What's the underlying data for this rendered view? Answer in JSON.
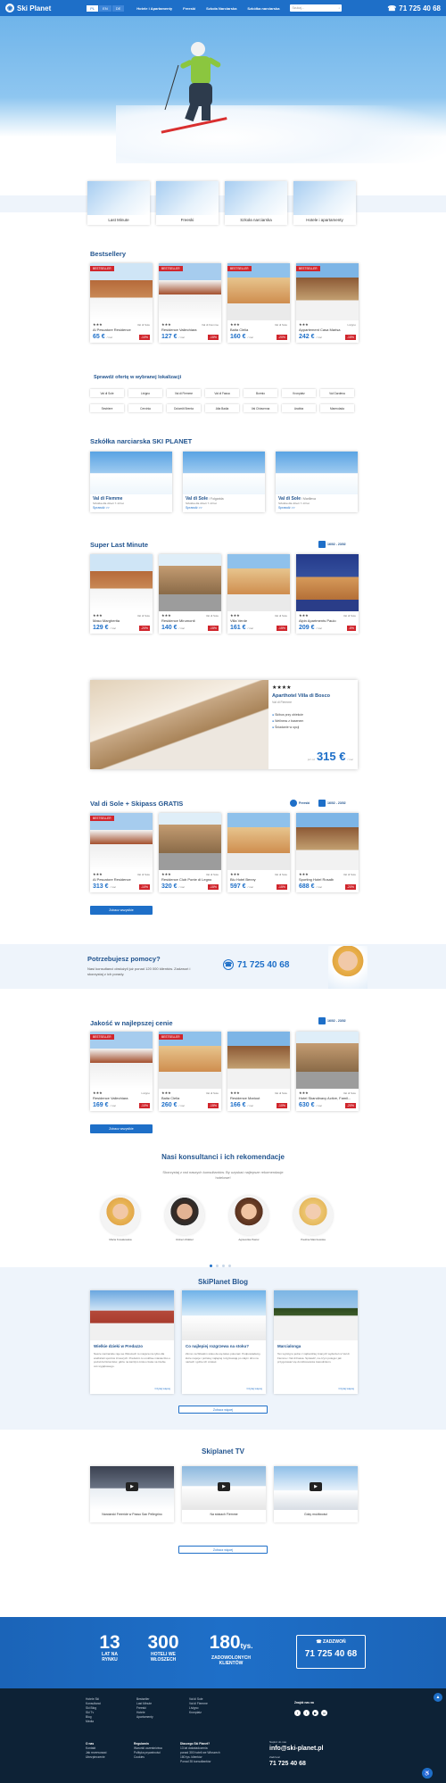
{
  "header": {
    "logo": "Ski Planet",
    "languages": [
      "PL",
      "EN",
      "DE"
    ],
    "nav": [
      "Hotele i Apartamenty",
      "Freeski",
      "Szkoła Narciarska",
      "Szkółka narciarska"
    ],
    "search_placeholder": "Szukaj...",
    "phone": "71 725 40 68"
  },
  "categories": [
    "Last Minute",
    "Freeski",
    "Szkoła narciarska",
    "Hotele i apartamenty"
  ],
  "bestsellers": {
    "title": "Bestsellery",
    "items": [
      {
        "badge": "BESTSELLER",
        "stars": "★★★",
        "loc": "Val di Sole",
        "name": "Al Pescatore Residence",
        "price": "65 €",
        "unit": "/ noc",
        "disc": "-10%"
      },
      {
        "badge": "BESTSELLER",
        "stars": "★★★",
        "loc": "Val di Fiemme",
        "name": "Residence Vallechiara",
        "price": "127 €",
        "unit": "/ noc",
        "disc": "-15%"
      },
      {
        "badge": "BESTSELLER",
        "stars": "★★★",
        "loc": "Val di Sole",
        "name": "Baita Clelia",
        "price": "160 €",
        "unit": "/ noc",
        "disc": "-20%"
      },
      {
        "badge": "BESTSELLER",
        "stars": "★★★",
        "loc": "Livigno",
        "name": "Appartement Casa Marisa",
        "price": "242 €",
        "unit": "/ noc",
        "disc": "-15%"
      }
    ]
  },
  "locations": {
    "title": "Sprawdź ofertę w wybranej lokalizacji",
    "items": [
      "Val di Sole",
      "Livigno",
      "Val di Fiemme",
      "Val di Fassa",
      "Bormio",
      "Kronplatz",
      "Val Gardena",
      "Sestriere",
      "Cervinia",
      "Dolomiti Brenta",
      "Alta Badia",
      "Val Chiavenna",
      "Arabba",
      "Marmolada"
    ]
  },
  "school": {
    "title": "Szkółka narciarska SKI PLANET",
    "items": [
      {
        "name": "Val di Fiemme",
        "sub": "",
        "desc": "Szkółka dla dzieci 7-13 lat",
        "link": "Sprawdź >>"
      },
      {
        "name": "Val di Sole",
        "sub": " / Folgarida",
        "desc": "Szkółka dla dzieci 7-13 lat",
        "link": "Sprawdź >>"
      },
      {
        "name": "Val di Sole",
        "sub": " / Marilleva",
        "desc": "Szkółka dla dzieci 7-13 lat",
        "link": "Sprawdź >>"
      }
    ]
  },
  "lastminute": {
    "title": "Super Last Minute",
    "date": "16/02 - 23/02",
    "items": [
      {
        "stars": "★★★",
        "loc": "Val di Sole",
        "name": "Maso Margherita",
        "price": "129 €",
        "unit": "/ noc",
        "disc": "-20%"
      },
      {
        "stars": "★★★",
        "loc": "Val di Sole",
        "name": "Residence Mirumonti",
        "price": "140 €",
        "unit": "/ noc",
        "disc": "-15%"
      },
      {
        "stars": "★★★",
        "loc": "Val di Sole",
        "name": "Villa Verde",
        "price": "161 €",
        "unit": "/ noc",
        "disc": "-15%"
      },
      {
        "stars": "★★★",
        "loc": "Val di Sole",
        "name": "Alpin Apartments Paulo",
        "price": "209 €",
        "unit": "/ noc",
        "disc": "-5%"
      }
    ]
  },
  "promo": {
    "stars": "★★★★",
    "name": "Aparthotel Villa di Bosco",
    "loc": "Val di Fiemme",
    "features": [
      "Skibus przy obiekcie",
      "Wellness z basenem",
      "Śniadanie w opcji"
    ],
    "from": "już od",
    "price": "315 €",
    "unit": "/ noc"
  },
  "skipass": {
    "title": "Val di Sole + Skipass GRATIS",
    "chip1": "Freeski",
    "date": "16/02 - 23/02",
    "items": [
      {
        "badge": "BESTSELLER",
        "stars": "★★★",
        "loc": "Val di Sole",
        "name": "Al Pescatore Residence",
        "price": "313 €",
        "unit": "/ noc",
        "disc": "-10%"
      },
      {
        "badge": "",
        "stars": "★★★",
        "loc": "Val di Sole",
        "name": "Residence Club Ponte di Legno",
        "price": "320 €",
        "unit": "/ noc",
        "disc": "-15%"
      },
      {
        "badge": "",
        "stars": "★★★",
        "loc": "Val di Sole",
        "name": "Blu Hotel Benny",
        "price": "597 €",
        "unit": "/ noc",
        "disc": "-15%"
      },
      {
        "badge": "",
        "stars": "★★★",
        "loc": "Val di Sole",
        "name": "Sporting Hotel Rosalb",
        "price": "688 €",
        "unit": "/ noc",
        "disc": "-20%"
      }
    ],
    "button": "Zobacz wszystkie"
  },
  "help": {
    "title": "Potrzebujesz pomocy?",
    "desc": "Nasi konsultanci obsłużyli już ponad 120 000 klientów. Zadzwoń i skorzystaj z ich porady.",
    "phone": "71 725 40 68"
  },
  "quality": {
    "title": "Jakość w najlepszej cenie",
    "date": "16/02 - 23/02",
    "items": [
      {
        "badge": "BESTSELLER",
        "stars": "★★★",
        "loc": "Livigno",
        "name": "Residence Vallechiara",
        "price": "169 €",
        "unit": "/ noc",
        "disc": "-10%"
      },
      {
        "badge": "BESTSELLER",
        "stars": "★★★",
        "loc": "Val di Sole",
        "name": "Baita Clelia",
        "price": "260 €",
        "unit": "/ noc",
        "disc": "-15%"
      },
      {
        "badge": "",
        "stars": "★★★",
        "loc": "Val di Sole",
        "name": "Residence Mariout",
        "price": "166 €",
        "unit": "/ noc",
        "disc": "-10%"
      },
      {
        "badge": "",
        "stars": "★★★",
        "loc": "Val di Sole",
        "name": "Hotel Skandinavy Active, Famil...",
        "price": "630 €",
        "unit": "/ noc",
        "disc": "-20%"
      }
    ],
    "button": "Zobacz wszystkie"
  },
  "consultants": {
    "title": "Nasi konsultanci i ich rekomendacje",
    "sub": "Skorzystaj z rad naszych konsultantów. By uzyskać najlepsze rekomendacje hotelowe!",
    "people": [
      "Marta Kowalewska",
      "Robert Ziółkiel",
      "Agnieszka Pastor",
      "Paulina Marczewska"
    ]
  },
  "blog": {
    "title": "SkiPlanet Blog",
    "posts": [
      {
        "title": "Wielkie dzieki w Predazzo",
        "excerpt": "Nasze narciarskie raje we Włoszech to miejsca nie tylko dla wielbicieli sportów zimowych. Predazzo to urokliwe miasteczko u podnóża Dolomitów, gdzie na każdym kroku czeka na Ciebie coś wyjątkowego.",
        "more": "Czytaj więcej"
      },
      {
        "title": "Co najlepiej rozgrzewa na stoku?",
        "excerpt": "Zimno na Włoskim stoku da się łatwo pokonać. Podpowiadamy, które napoje i potrawy najlepiej rozgrzewają po całym dniu na nartach i gdzie ich szukać.",
        "more": "Czytaj więcej"
      },
      {
        "title": "Marcialonga",
        "excerpt": "Ten wyścig to jedno z najbardziej znanych wydarzeń w Val di Fiemme i Val di Fassa. Sprawdź, na czym polega i jak przygotować się do kibicowania zawodnikom.",
        "more": "Czytaj więcej"
      }
    ],
    "button": "Zobacz więcej"
  },
  "tv": {
    "title": "Skiplanet TV",
    "videos": [
      "Narciarski Freeride w Passo San Pellegrino",
      "Na stokach Fiemme",
      "Gdzy możliwości"
    ],
    "button": "Zobacz więcej"
  },
  "stats": [
    {
      "n": "13",
      "suffix": "",
      "l": "LAT NA RYNKU"
    },
    {
      "n": "300",
      "suffix": "",
      "l": "HOTELI WE WŁOSZECH"
    },
    {
      "n": "180",
      "suffix": "tys.",
      "l": "ZADOWOLONYCH KLIENTÓW"
    }
  ],
  "call": {
    "label": "ZADZWOŃ",
    "phone": "71 725 40 68"
  },
  "footer": {
    "col1": [
      "Hotele Ski",
      "Konsultanci",
      "Ski Blog",
      "Ski Tv",
      "Blog",
      "Media"
    ],
    "col2": [
      "Bestseller",
      "Last Minute",
      "Freeski",
      "Hotele",
      "Apartamenty"
    ],
    "col3": [
      "Val di Sole",
      "Val di Fiemme",
      "Livigno",
      "Kronplatz"
    ],
    "follow": "Znajdź nas na",
    "col4_title": "O nas",
    "col4": [
      "Kontakt",
      "Jak rezerwować",
      "Ubezpieczenie"
    ],
    "col5_title": "Regulamin",
    "col5": [
      "Warunki uczestnictwa",
      "Polityka prywatności",
      "Cookies"
    ],
    "why_title": "Dlaczego Ski Planet?",
    "why": [
      "13 lat doświadczenia",
      "ponad 300 hoteli we Włoszech",
      "180 tys. klientów",
      "Ponad 35 konsultantów"
    ],
    "mail_label": "Napisz do nas",
    "mail": "info@ski-planet.pl",
    "phone_label": "Zadzwoń",
    "phone": "71 725 40 68"
  }
}
